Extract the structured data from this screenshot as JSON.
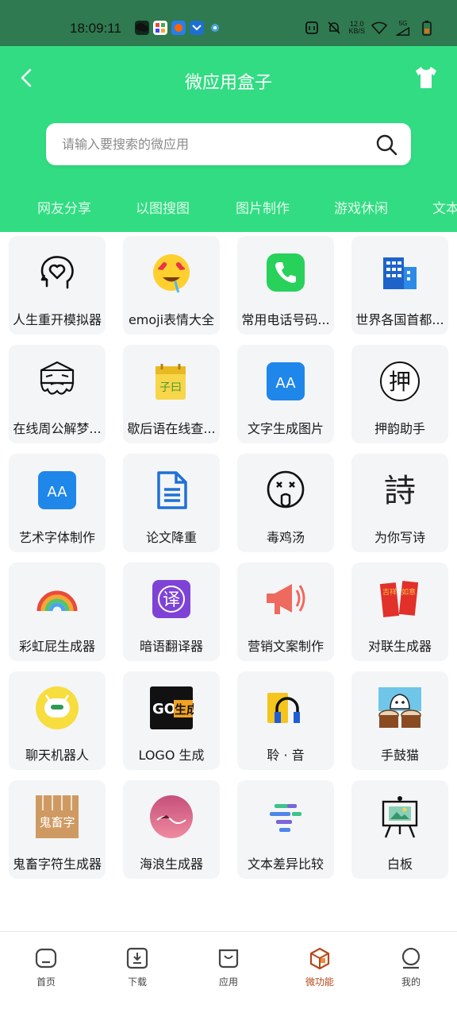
{
  "status_bar": {
    "time": "18:09:11",
    "speed_value": "12.0",
    "speed_unit": "KB/S",
    "network": "5G"
  },
  "header": {
    "title": "微应用盒子",
    "back_icon": "chevron-left-icon",
    "theme_icon": "tshirt-icon"
  },
  "search": {
    "placeholder": "请输入要搜索的微应用",
    "value": ""
  },
  "tabs": [
    "网友分享",
    "以图搜图",
    "图片制作",
    "游戏休闲",
    "文本"
  ],
  "apps": [
    {
      "label": "人生重开模拟器",
      "icon": "heart-head-icon"
    },
    {
      "label": "emoji表情大全",
      "icon": "heart-eyes-emoji-icon"
    },
    {
      "label": "常用电话号码...",
      "icon": "phone-icon"
    },
    {
      "label": "世界各国首都...",
      "icon": "buildings-icon"
    },
    {
      "label": "在线周公解梦...",
      "icon": "old-man-icon"
    },
    {
      "label": "歇后语在线查...",
      "icon": "calendar-book-icon"
    },
    {
      "label": "文字生成图片",
      "icon": "text-aa-icon"
    },
    {
      "label": "押韵助手",
      "icon": "ya-character-icon"
    },
    {
      "label": "艺术字体制作",
      "icon": "font-aa-icon"
    },
    {
      "label": "论文降重",
      "icon": "document-icon"
    },
    {
      "label": "毒鸡汤",
      "icon": "sick-face-icon"
    },
    {
      "label": "为你写诗",
      "icon": "poem-character-icon"
    },
    {
      "label": "彩虹屁生成器",
      "icon": "rainbow-icon"
    },
    {
      "label": "暗语翻译器",
      "icon": "translate-icon"
    },
    {
      "label": "营销文案制作",
      "icon": "megaphone-icon"
    },
    {
      "label": "对联生成器",
      "icon": "couplet-icon"
    },
    {
      "label": "聊天机器人",
      "icon": "robot-icon"
    },
    {
      "label": "LOGO 生成",
      "icon": "logo-go-icon"
    },
    {
      "label": "聆 · 音",
      "icon": "headphones-icon"
    },
    {
      "label": "手鼓猫",
      "icon": "drum-cat-icon"
    },
    {
      "label": "鬼畜字符生成器",
      "icon": "ghost-text-icon"
    },
    {
      "label": "海浪生成器",
      "icon": "wave-icon"
    },
    {
      "label": "文本差异比较",
      "icon": "diff-icon"
    },
    {
      "label": "白板",
      "icon": "whiteboard-icon"
    }
  ],
  "icon_text": {
    "ya": "押",
    "poem": "詩",
    "go": "GO",
    "sheng": "生成",
    "guichu": "鬼畜字",
    "yi": "译",
    "aa": "AA",
    "couplet_left": "吉祥",
    "couplet_right": "如意",
    "calendar": "子曰"
  },
  "bottom_nav": [
    {
      "label": "首页",
      "icon": "home-icon"
    },
    {
      "label": "下载",
      "icon": "download-icon"
    },
    {
      "label": "应用",
      "icon": "bag-icon"
    },
    {
      "label": "微功能",
      "icon": "box-icon",
      "active": true
    },
    {
      "label": "我的",
      "icon": "profile-icon"
    }
  ],
  "colors": {
    "header_green": "#32dc82",
    "status_green": "#2f7a50",
    "active_nav": "#b5481a",
    "card_bg": "#f4f5f7"
  }
}
